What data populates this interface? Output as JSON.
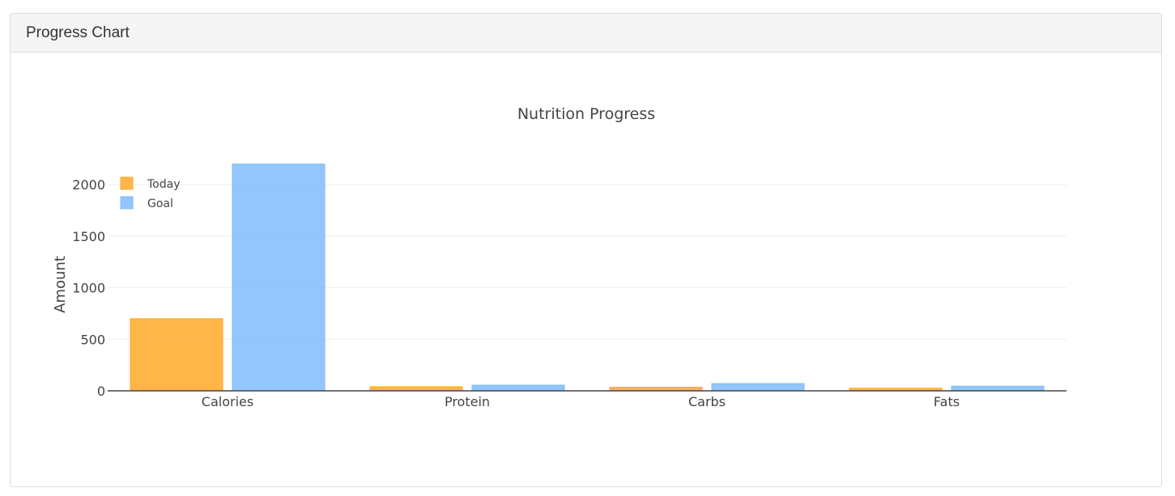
{
  "panel": {
    "title": "Progress Chart"
  },
  "chart_data": {
    "type": "bar",
    "title": "Nutrition Progress",
    "xlabel": "",
    "ylabel": "Amount",
    "categories": [
      "Calories",
      "Protein",
      "Carbs",
      "Fats"
    ],
    "series": [
      {
        "name": "Today",
        "values": [
          700,
          40,
          35,
          25
        ],
        "color": "#ffa929"
      },
      {
        "name": "Goal",
        "values": [
          2200,
          55,
          70,
          45
        ],
        "color": "#7fbcfb"
      }
    ],
    "ylim": [
      0,
      2300
    ],
    "yticks": [
      0,
      500,
      1000,
      1500,
      2000
    ],
    "grid": true,
    "legend_position": "top-left"
  }
}
